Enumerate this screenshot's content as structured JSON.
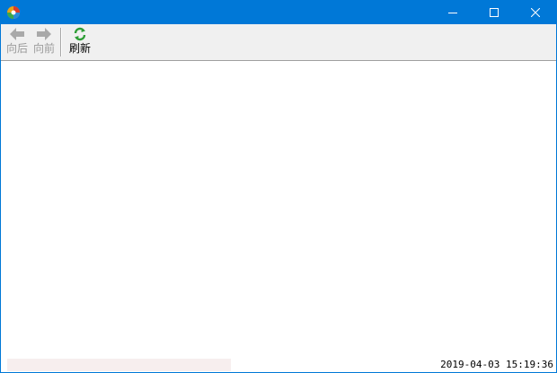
{
  "window": {
    "title": "",
    "title_bar_color": "#0078d7"
  },
  "toolbar": {
    "back": {
      "label": "向后",
      "icon": "arrow-left-icon",
      "enabled": false
    },
    "forward": {
      "label": "向前",
      "icon": "arrow-right-icon",
      "enabled": false
    },
    "refresh": {
      "label": "刷新",
      "icon": "refresh-icon",
      "enabled": true
    }
  },
  "status": {
    "left_text": "",
    "datetime": "2019-04-03 15:19:36"
  }
}
